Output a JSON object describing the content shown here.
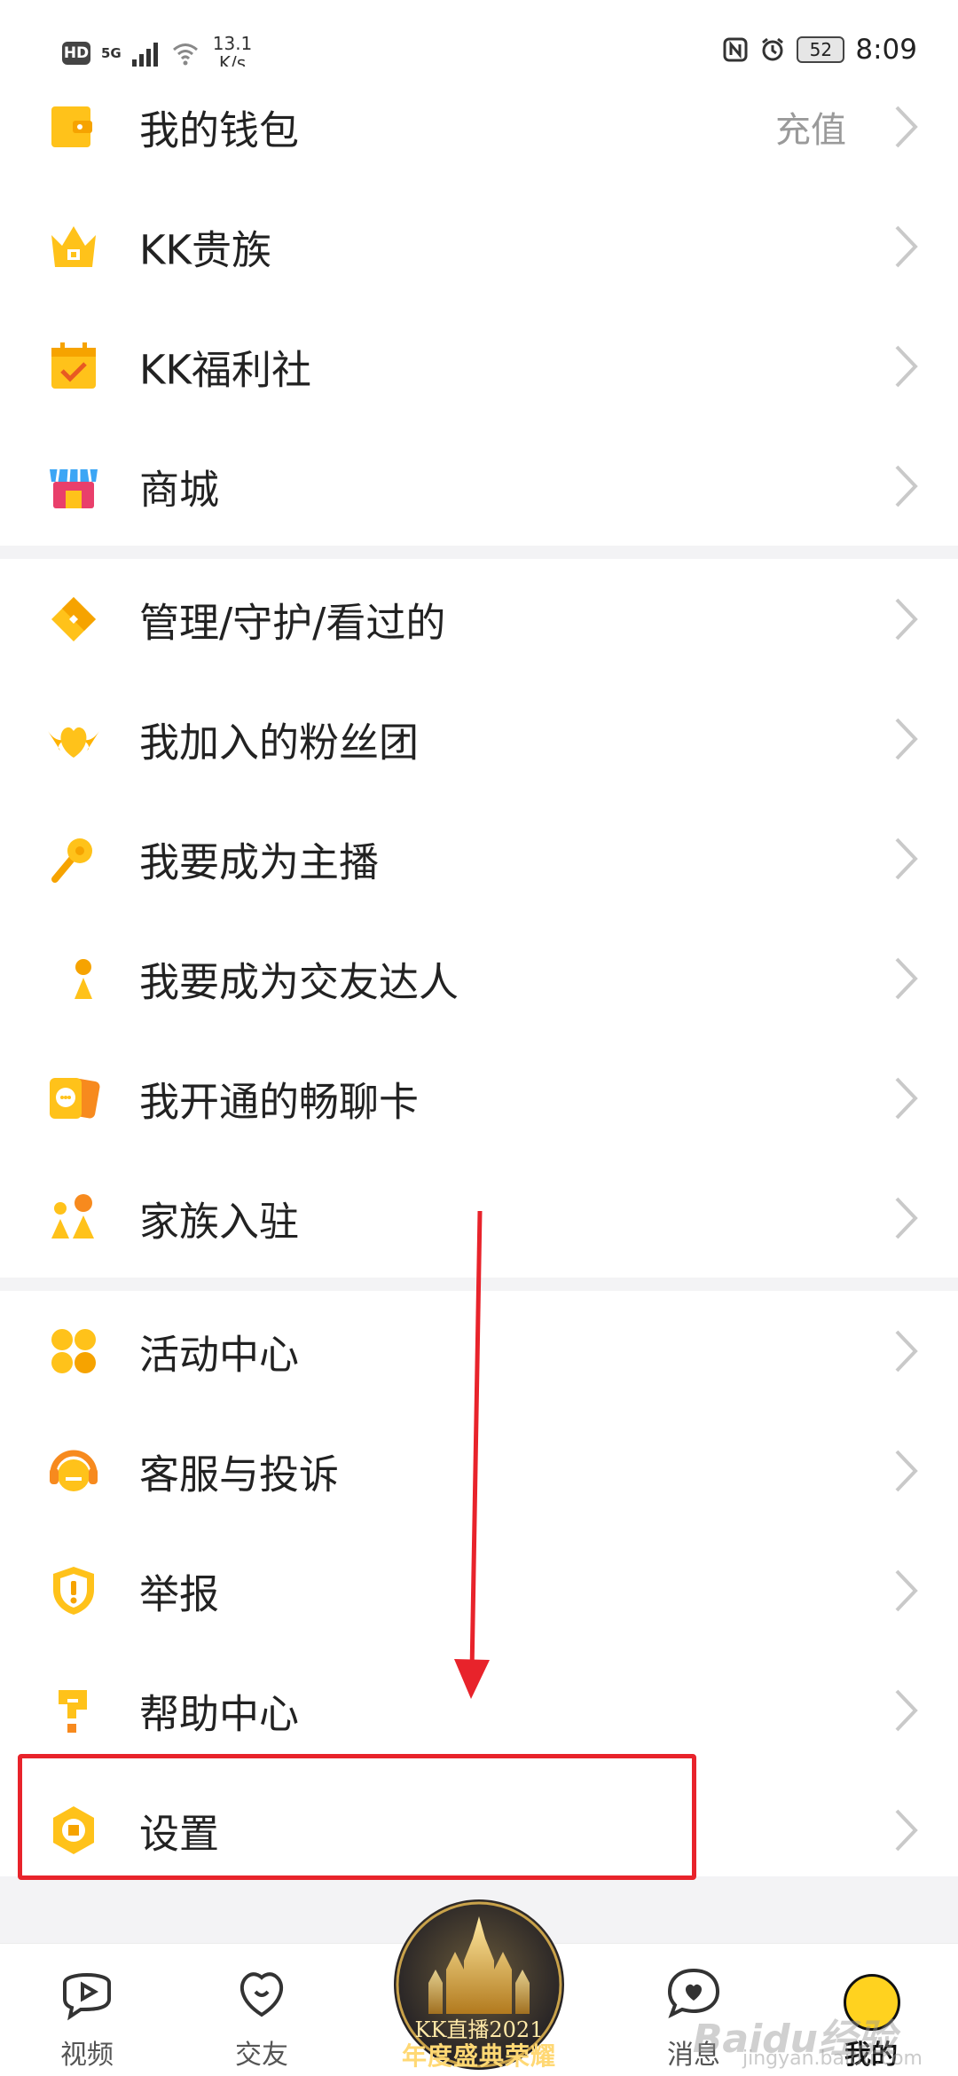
{
  "status_bar": {
    "hd": "HD",
    "network": "5G",
    "speed_value": "13.1",
    "speed_unit": "K/s",
    "battery": "52",
    "time": "8:09"
  },
  "menu": {
    "group1": [
      {
        "label": "我的钱包",
        "extra": "充值",
        "icon": "wallet-icon"
      },
      {
        "label": "KK贵族",
        "icon": "crown-icon"
      },
      {
        "label": "KK福利社",
        "icon": "calendar-check-icon"
      },
      {
        "label": "商城",
        "icon": "shop-icon"
      }
    ],
    "group2": [
      {
        "label": "管理/守护/看过的",
        "icon": "diamond-icon"
      },
      {
        "label": "我加入的粉丝团",
        "icon": "winged-heart-icon"
      },
      {
        "label": "我要成为主播",
        "icon": "microphone-icon"
      },
      {
        "label": "我要成为交友达人",
        "icon": "moon-person-icon"
      },
      {
        "label": "我开通的畅聊卡",
        "icon": "chat-card-icon"
      },
      {
        "label": "家族入驻",
        "icon": "family-icon"
      }
    ],
    "group3": [
      {
        "label": "活动中心",
        "icon": "clover-icon"
      },
      {
        "label": "客服与投诉",
        "icon": "headset-icon"
      },
      {
        "label": "举报",
        "icon": "shield-alert-icon"
      },
      {
        "label": "帮助中心",
        "icon": "question-icon"
      },
      {
        "label": "设置",
        "icon": "settings-icon"
      }
    ]
  },
  "center_badge": {
    "line1": "KK直播2021",
    "line2": "年度盛典荣耀榜"
  },
  "tabbar": {
    "items": [
      {
        "label": "视频",
        "icon": "video-play-icon"
      },
      {
        "label": "交友",
        "icon": "heart-icon"
      },
      {
        "label": "消息",
        "icon": "message-heart-icon"
      },
      {
        "label": "我的",
        "icon": "avatar-icon"
      }
    ]
  },
  "watermark": {
    "brand": "Baidu经验",
    "url": "jingyan.baidu.com"
  },
  "colors": {
    "accent_yellow": "#FFC21A",
    "highlight_red": "#E8232B",
    "separator": "#F3F3F5"
  }
}
